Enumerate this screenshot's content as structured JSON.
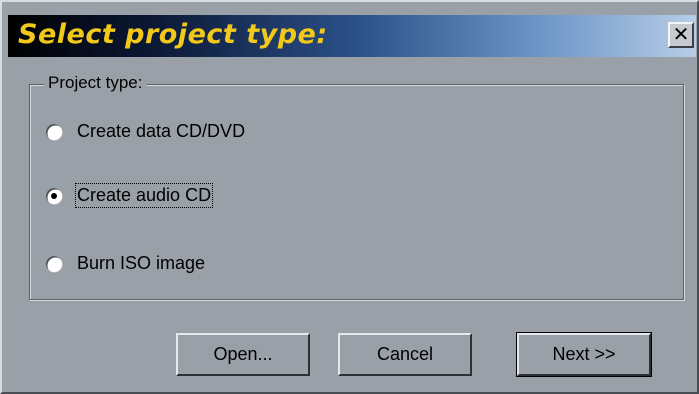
{
  "dialog": {
    "title": "Select project type:",
    "close_label": "✕"
  },
  "group": {
    "label": "Project type:",
    "options": [
      {
        "label": "Create data CD/DVD",
        "checked": false
      },
      {
        "label": "Create audio CD",
        "checked": true
      },
      {
        "label": "Burn ISO image",
        "checked": false
      }
    ]
  },
  "buttons": {
    "open": "Open...",
    "cancel": "Cancel",
    "next": "Next >>"
  },
  "colors": {
    "title_text": "#f2c81a",
    "face": "#9aa0a8"
  }
}
